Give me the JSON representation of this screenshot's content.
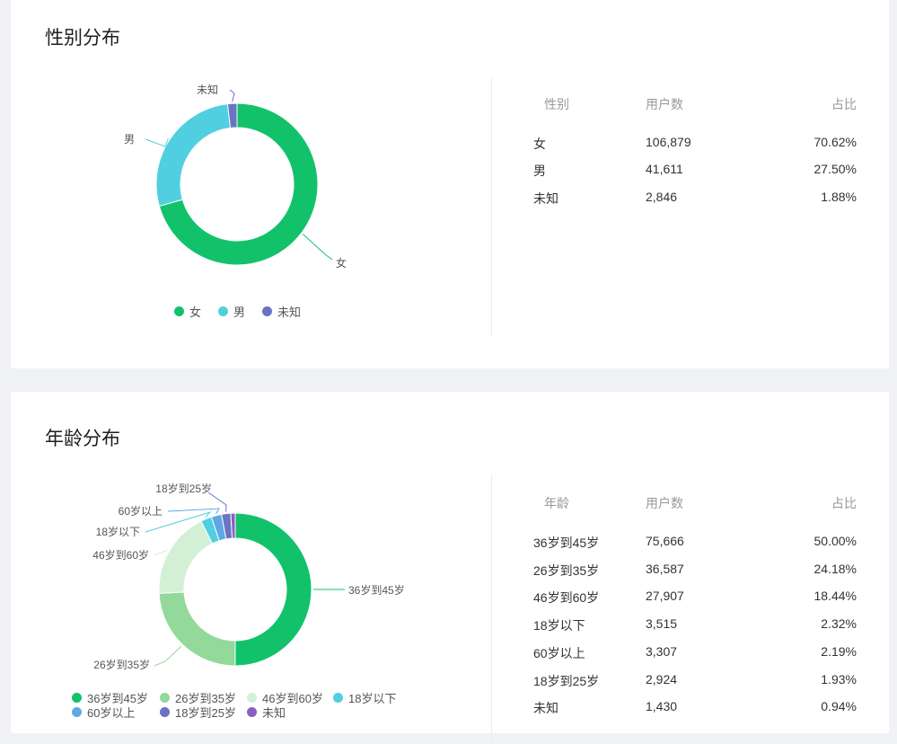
{
  "gender": {
    "title": "性别分布",
    "table": {
      "headers": [
        "性别",
        "用户数",
        "占比"
      ],
      "rows": [
        [
          "女",
          "106,879",
          "70.62%"
        ],
        [
          "男",
          "41,611",
          "27.50%"
        ],
        [
          "未知",
          "2,846",
          "1.88%"
        ]
      ]
    },
    "legend": [
      "女",
      "男",
      "未知"
    ]
  },
  "age": {
    "title": "年龄分布",
    "table": {
      "headers": [
        "年龄",
        "用户数",
        "占比"
      ],
      "rows": [
        [
          "36岁到45岁",
          "75,666",
          "50.00%"
        ],
        [
          "26岁到35岁",
          "36,587",
          "24.18%"
        ],
        [
          "46岁到60岁",
          "27,907",
          "18.44%"
        ],
        [
          "18岁以下",
          "3,515",
          "2.32%"
        ],
        [
          "60岁以上",
          "3,307",
          "2.19%"
        ],
        [
          "18岁到25岁",
          "2,924",
          "1.93%"
        ],
        [
          "未知",
          "1,430",
          "0.94%"
        ]
      ]
    },
    "legend": [
      "36岁到45岁",
      "26岁到35岁",
      "46岁到60岁",
      "18岁以下",
      "60岁以上",
      "18岁到25岁",
      "未知"
    ]
  },
  "chart_data": [
    {
      "type": "pie",
      "title": "性别分布",
      "categories": [
        "女",
        "男",
        "未知"
      ],
      "values": [
        106879,
        41611,
        2846
      ],
      "colors": [
        "#12c26b",
        "#4fcfe0",
        "#6b73c3"
      ],
      "legend_position": "bottom"
    },
    {
      "type": "pie",
      "title": "年龄分布",
      "categories": [
        "36岁到45岁",
        "26岁到35岁",
        "46岁到60岁",
        "18岁以下",
        "60岁以上",
        "18岁到25岁",
        "未知"
      ],
      "values": [
        75666,
        36587,
        27907,
        3515,
        3307,
        2924,
        1430
      ],
      "colors": [
        "#12c26b",
        "#92d99a",
        "#d3f0d6",
        "#4fcfe0",
        "#5fa8e3",
        "#6b73c3",
        "#8a5fbf"
      ],
      "legend_position": "bottom"
    }
  ]
}
